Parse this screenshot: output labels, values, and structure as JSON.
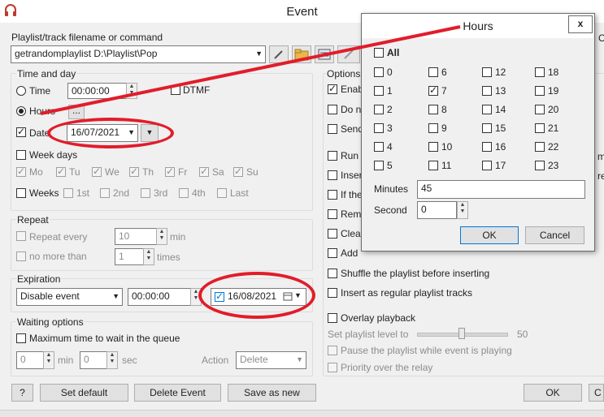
{
  "window": {
    "title": "Event"
  },
  "playlist": {
    "label": "Playlist/track filename or command",
    "value": "getrandomplaylist D:\\Playlist\\Pop",
    "partial_right": "C"
  },
  "time_and_day": {
    "group_label": "Time and day",
    "time_label": "Time",
    "time_value": "00:00:00",
    "dtmf_label": "DTMF",
    "hours_label": "Hours",
    "hours_button": "...",
    "date_label": "Date",
    "date_value": "16/07/2021",
    "week_days_label": "Week days",
    "days": [
      "Mo",
      "Tu",
      "We",
      "Th",
      "Fr",
      "Sa",
      "Su"
    ],
    "weeks_label": "Weeks",
    "weeks": [
      "1st",
      "2nd",
      "3rd",
      "4th",
      "Last"
    ]
  },
  "repeat": {
    "group_label": "Repeat",
    "every_label": "Repeat every",
    "every_value": "10",
    "every_unit": "min",
    "no_more_label": "no more than",
    "no_more_value": "1",
    "no_more_unit": "times"
  },
  "expiration": {
    "group_label": "Expiration",
    "action_value": "Disable event",
    "time_value": "00:00:00",
    "date_value": "16/08/2021"
  },
  "waiting": {
    "group_label": "Waiting options",
    "max_time_label": "Maximum time to wait in the queue",
    "min_value": "0",
    "min_unit": "min",
    "sec_value": "0",
    "sec_unit": "sec",
    "action_label": "Action",
    "action_value": "Delete"
  },
  "options": {
    "group_label": "Options",
    "items_partial": [
      "Enab",
      "Do n",
      "Send"
    ],
    "items_partial2": [
      "Run",
      "Inser",
      "If the",
      "Rem",
      "Clea",
      "Add"
    ],
    "shuffle": "Shuffle the playlist before inserting",
    "regular": "Insert as regular playlist tracks",
    "overlay": "Overlay playback",
    "set_level_label": "Set playlist level to",
    "level_value": "50",
    "pause": "Pause the playlist while event is playing",
    "priority": "Priority over the relay",
    "right_partial": [
      "mi",
      "re"
    ]
  },
  "buttons": {
    "help": "?",
    "set_default": "Set default",
    "delete_event": "Delete Event",
    "save_as_new": "Save as new",
    "ok": "OK",
    "partial_right": "C"
  },
  "hours_dialog": {
    "title": "Hours",
    "close": "x",
    "all_label": "All",
    "hours": [
      "0",
      "1",
      "2",
      "3",
      "4",
      "5",
      "6",
      "7",
      "8",
      "9",
      "10",
      "11",
      "12",
      "13",
      "14",
      "15",
      "16",
      "17",
      "18",
      "19",
      "20",
      "21",
      "22",
      "23"
    ],
    "checked_hour": "7",
    "minutes_label": "Minutes",
    "minutes_value": "45",
    "second_label": "Second",
    "second_value": "0",
    "ok": "OK",
    "cancel": "Cancel"
  },
  "colors": {
    "annotation_red": "#e11d2a",
    "focus_blue": "#0078d7"
  }
}
